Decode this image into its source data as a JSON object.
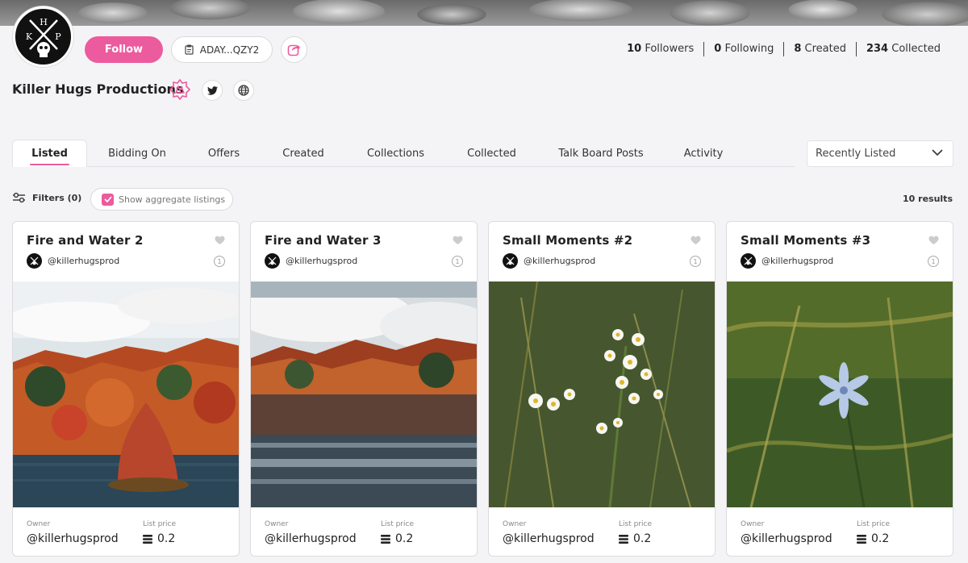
{
  "profile": {
    "name": "Killer Hugs Productions",
    "avatar_letters": [
      "K",
      "H",
      "P"
    ],
    "follow_label": "Follow",
    "address": "ADAY...QZY2",
    "stats": [
      {
        "value": "10",
        "label": "Followers"
      },
      {
        "value": "0",
        "label": "Following"
      },
      {
        "value": "8",
        "label": "Created"
      },
      {
        "value": "234",
        "label": "Collected"
      }
    ]
  },
  "tabs": [
    "Listed",
    "Bidding On",
    "Offers",
    "Created",
    "Collections",
    "Collected",
    "Talk Board Posts",
    "Activity"
  ],
  "active_tab": "Listed",
  "sort": {
    "selected": "Recently Listed"
  },
  "filters": {
    "label": "Filters (0)",
    "aggregate_label": "Show aggregate listings",
    "aggregate_checked": true,
    "results": "10 results"
  },
  "cards": [
    {
      "title": "Fire and Water 2",
      "creator": "@killerhugsprod",
      "edition_icon": "edition-1-icon",
      "owner_label": "Owner",
      "owner": "@killerhugsprod",
      "price_label": "List price",
      "price": "0.2"
    },
    {
      "title": "Fire and Water 3",
      "creator": "@killerhugsprod",
      "edition_icon": "edition-1-icon",
      "owner_label": "Owner",
      "owner": "@killerhugsprod",
      "price_label": "List price",
      "price": "0.2"
    },
    {
      "title": "Small Moments #2",
      "creator": "@killerhugsprod",
      "edition_icon": "edition-1-icon",
      "owner_label": "Owner",
      "owner": "@killerhugsprod",
      "price_label": "List price",
      "price": "0.2"
    },
    {
      "title": "Small Moments #3",
      "creator": "@killerhugsprod",
      "edition_icon": "edition-1-icon",
      "owner_label": "Owner",
      "owner": "@killerhugsprod",
      "price_label": "List price",
      "price": "0.2"
    }
  ],
  "colors": {
    "accent": "#ec5b9e",
    "background": "#f4f4f6"
  }
}
